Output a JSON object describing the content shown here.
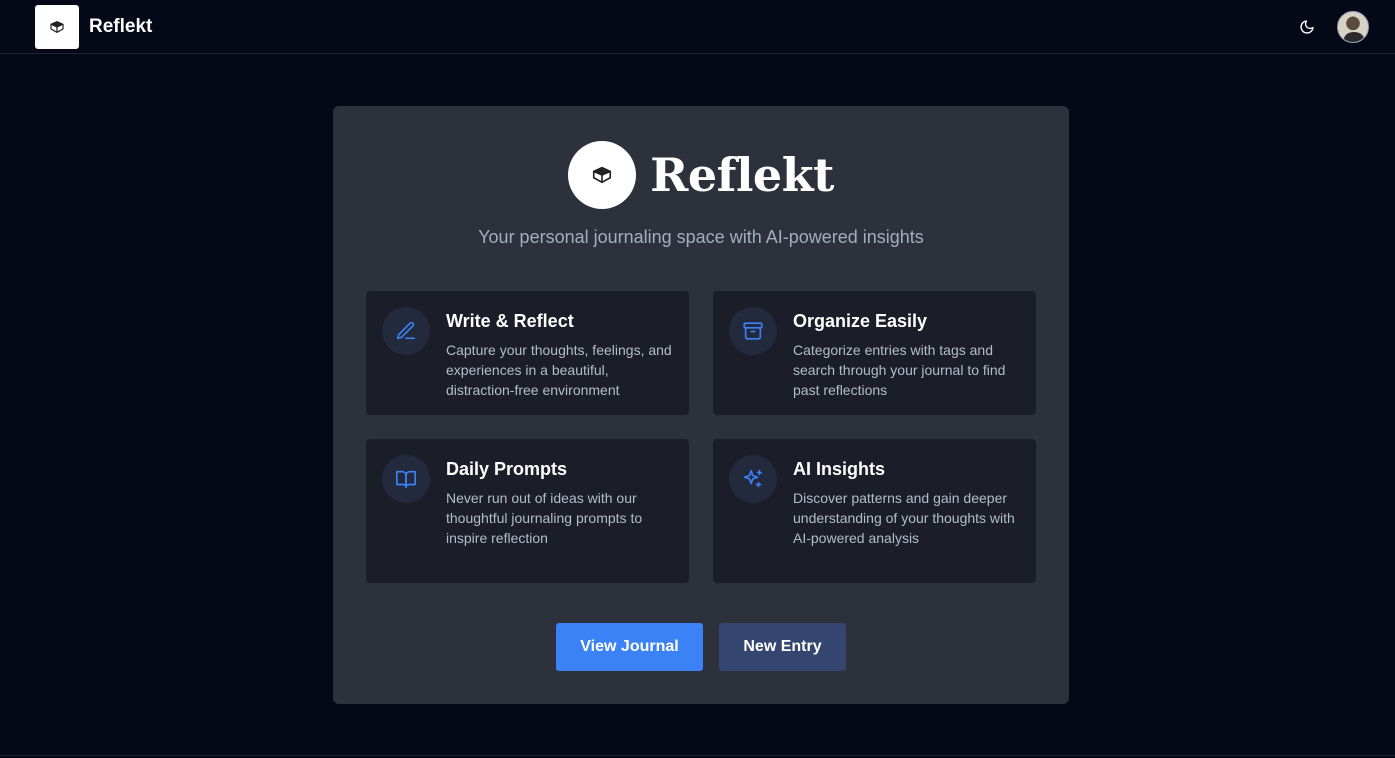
{
  "app": {
    "name": "Reflekt"
  },
  "header": {
    "brand_name": "Reflekt",
    "icons": [
      "book-logo-icon",
      "moon-icon",
      "avatar"
    ]
  },
  "hero": {
    "title": "Reflekt",
    "subtitle": "Your personal journaling space with AI-powered insights"
  },
  "features": [
    {
      "icon": "pencil-icon",
      "title": "Write & Reflect",
      "description": "Capture your thoughts, feelings, and experiences in a beautiful, distraction-free environment"
    },
    {
      "icon": "archive-icon",
      "title": "Organize Easily",
      "description": "Categorize entries with tags and search through your journal to find past reflections"
    },
    {
      "icon": "open-book-icon",
      "title": "Daily Prompts",
      "description": "Never run out of ideas with our thoughtful journaling prompts to inspire reflection"
    },
    {
      "icon": "sparkles-icon",
      "title": "AI Insights",
      "description": "Discover patterns and gain deeper understanding of your thoughts with AI-powered analysis"
    }
  ],
  "actions": {
    "view_journal": "View Journal",
    "new_entry": "New Entry"
  },
  "colors": {
    "background": "#040817",
    "card": "#2d313c",
    "feature_card": "#1b1e28",
    "accent": "#3b82f6",
    "secondary_button": "#34466f"
  }
}
